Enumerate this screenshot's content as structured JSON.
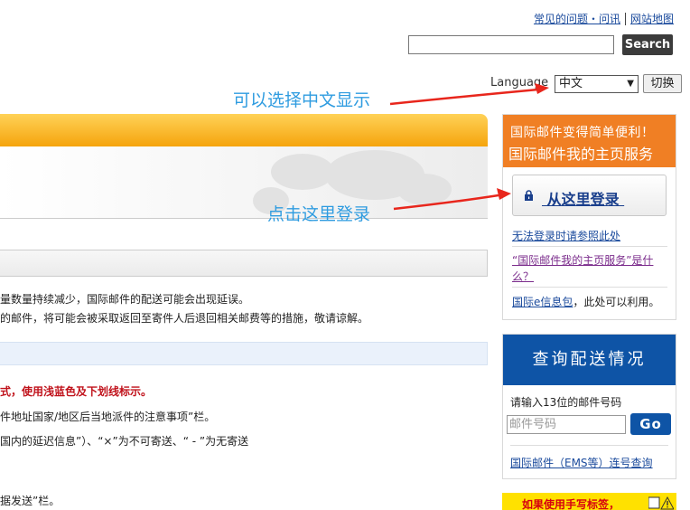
{
  "header": {
    "faq_link": "常见的问题・问讯",
    "sitemap_link": "网站地图",
    "search_placeholder": "",
    "search_button": "Search"
  },
  "language": {
    "label": "Language",
    "selected": "中文",
    "switch_button": "切换"
  },
  "annotations": {
    "select_chinese": "可以选择中文显示",
    "click_login": "点击这里登录"
  },
  "main": {
    "notice_line1": "量数量持续减少，国际邮件的配送可能会出现延误。",
    "notice_line2": "的邮件，将可能会被采取返回至寄件人后退回相关邮费等的措施，敬请谅解。",
    "red_notice": "式，使用浅蓝色及下划线标示。",
    "line_a": "件地址国家/地区后当地派件的注意事项”栏。",
    "line_b": "国内的延迟信息”）、“×”为不可寄送、“ - ”为无寄送",
    "line_c": "据发送”栏。"
  },
  "mypage_panel": {
    "title_line1": "国际邮件变得简单便利！",
    "title_line2": "国际邮件我的主页服务",
    "login_button": " 从这里登录 ",
    "cannot_login_link": "无法登录时请参照此处",
    "what_is_link": "“国际邮件我的主页服务”是什么？",
    "einfo_link": "国际e信息包",
    "einfo_suffix": "，此处可以利用。"
  },
  "tracking_panel": {
    "title": "查询配送情况",
    "hint": "请输入13位的邮件号码",
    "input_placeholder": "邮件号码",
    "go_button": "Go",
    "ems_link": "国际邮件（EMS等）连号查询"
  },
  "banner": {
    "text": "如果使用手写标签，"
  },
  "colors": {
    "orange": "#f07f24",
    "blue": "#0e54a6",
    "link": "#1a4a9c",
    "annotation": "#2f9ce0",
    "arrow": "#e8261c",
    "alert_red": "#c0121b"
  }
}
